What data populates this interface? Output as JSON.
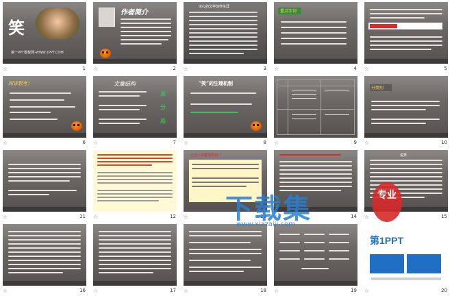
{
  "slides": [
    {
      "n": "1",
      "title": "笑",
      "sub": "第一PPT模板网-WWW.1PPT.COM"
    },
    {
      "n": "2",
      "title": "作者简介"
    },
    {
      "n": "3",
      "title": "冰心的文学创作生涯"
    },
    {
      "n": "4",
      "title": "重点字词"
    },
    {
      "n": "5",
      "title": ""
    },
    {
      "n": "6",
      "title": "阅读思考："
    },
    {
      "n": "7",
      "title": "文章结构",
      "items": [
        "总",
        "分",
        "总"
      ]
    },
    {
      "n": "8",
      "title": "“笑”的生理机制"
    },
    {
      "n": "9",
      "title": ""
    },
    {
      "n": "10",
      "title": "分类别"
    },
    {
      "n": "11",
      "title": ""
    },
    {
      "n": "12",
      "title": ""
    },
    {
      "n": "13",
      "title": "“让全人类都有笑容，”"
    },
    {
      "n": "14",
      "title": ""
    },
    {
      "n": "15",
      "title": "说笑"
    },
    {
      "n": "16",
      "title": ""
    },
    {
      "n": "17",
      "title": ""
    },
    {
      "n": "18",
      "title": ""
    },
    {
      "n": "19",
      "title": ""
    },
    {
      "n": "20",
      "title": "第1PPT"
    }
  ],
  "watermark": {
    "main": "下载集",
    "side": "专业",
    "url": "www.xiazaiji.com"
  },
  "colors": {
    "accent": "#e02a2a",
    "pumpkin": "#e06a00",
    "green": "#3fbf5a",
    "title_yellow": "#f0d060"
  }
}
